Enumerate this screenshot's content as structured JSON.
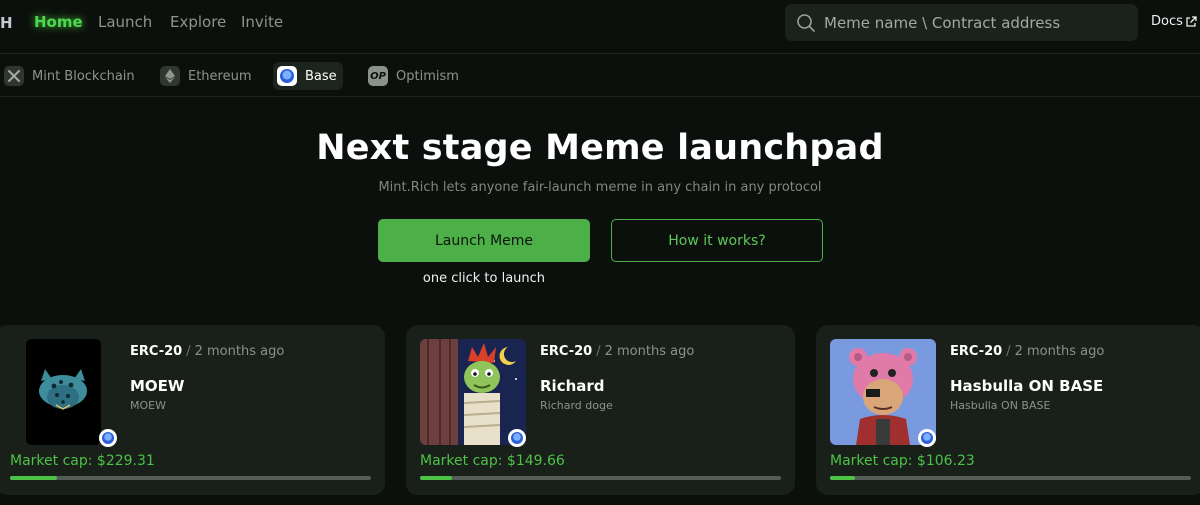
{
  "nav": {
    "logo": "H",
    "links": [
      "Home",
      "Launch",
      "Explore",
      "Invite"
    ],
    "search_placeholder": "Meme name \\ Contract address",
    "docs": "Docs"
  },
  "chains": [
    {
      "label": "Mint Blockchain",
      "icon": "mint-icon",
      "active": false
    },
    {
      "label": "Ethereum",
      "icon": "ethereum-icon",
      "active": false
    },
    {
      "label": "Base",
      "icon": "base-icon",
      "active": true
    },
    {
      "label": "Optimism",
      "icon": "optimism-icon",
      "active": false
    }
  ],
  "hero": {
    "title": "Next stage Meme launchpad",
    "subtitle": "Mint.Rich lets anyone fair-launch meme in any chain in any protocol",
    "primary_button": "Launch Meme",
    "secondary_button": "How it works?",
    "hint": "one click to launch"
  },
  "cards": [
    {
      "standard": "ERC-20",
      "separator": "/",
      "age": "2 months ago",
      "name": "MOEW",
      "ticker": "MOEW",
      "market_cap": "Market cap: $229.31",
      "progress_percent": 13
    },
    {
      "standard": "ERC-20",
      "separator": "/",
      "age": "2 months ago",
      "name": "Richard",
      "ticker": "Richard doge",
      "market_cap": "Market cap: $149.66",
      "progress_percent": 9
    },
    {
      "standard": "ERC-20",
      "separator": "/",
      "age": "2 months ago",
      "name": "Hasbulla ON BASE",
      "ticker": "Hasbulla ON BASE",
      "market_cap": "Market cap: $106.23",
      "progress_percent": 7
    }
  ],
  "colors": {
    "accent": "#4caf47",
    "accent_text": "#4cc247",
    "background": "#0c100c",
    "card": "#191f19"
  }
}
